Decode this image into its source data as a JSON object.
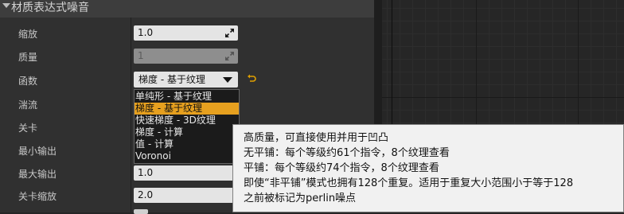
{
  "section": {
    "title": "材质表达式噪音"
  },
  "properties": {
    "scale_label": "缩放",
    "scale_value": "1.0",
    "quality_label": "质量",
    "quality_value": "1",
    "function_label": "函数",
    "function_value": "梯度 - 基于纹理",
    "turbulence_label": "湍流",
    "levels_label": "关卡",
    "min_output_label": "最小输出",
    "max_output_label": "最大输出",
    "max_output_value": "1.0",
    "level_scale_label": "关卡缩放",
    "level_scale_value": "2.0"
  },
  "dropdown": {
    "options": [
      "单纯形 - 基于纹理",
      "梯度 - 基于纹理",
      "快速梯度 - 3D纹理",
      "梯度 - 计算",
      "值 - 计算",
      "Voronoi"
    ],
    "selected_index": 1
  },
  "tooltip": {
    "lines": [
      "高质量，可直接使用并用于凹凸",
      "无平铺：每个等级约61个指令，8个纹理查看",
      "平铺：每个等级约74个指令，8个纹理查看",
      "即使“非平铺”模式也拥有128个重复。适用于重复大小范围小于等于128",
      "之前被标记为perlin噪点"
    ]
  },
  "icons": {
    "section_collapse": "chevron-down-icon",
    "expand": "expand-arrows-icon",
    "reset": "reset-to-default-icon",
    "combo_arrow": "dropdown-arrow-icon"
  },
  "colors": {
    "panel_bg": "#303030",
    "header_bg": "#3d3d3d",
    "field_bg": "#e4e4e4",
    "selection": "#e6a01f",
    "tooltip_bg": "#f1f1f1",
    "reset_icon": "#e0a000"
  }
}
